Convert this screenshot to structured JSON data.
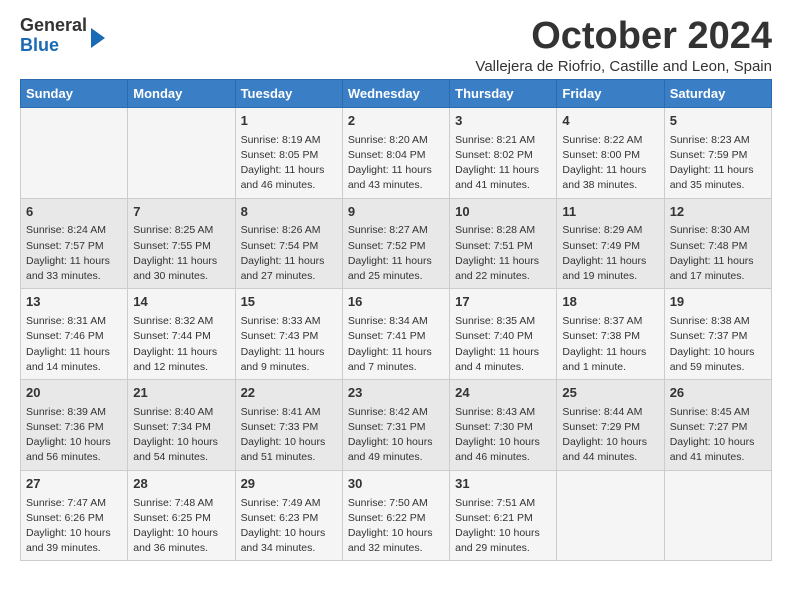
{
  "header": {
    "logo_general": "General",
    "logo_blue": "Blue",
    "month_title": "October 2024",
    "subtitle": "Vallejera de Riofrio, Castille and Leon, Spain"
  },
  "days_of_week": [
    "Sunday",
    "Monday",
    "Tuesday",
    "Wednesday",
    "Thursday",
    "Friday",
    "Saturday"
  ],
  "weeks": [
    [
      {
        "day": "",
        "info": ""
      },
      {
        "day": "",
        "info": ""
      },
      {
        "day": "1",
        "info": "Sunrise: 8:19 AM\nSunset: 8:05 PM\nDaylight: 11 hours and 46 minutes."
      },
      {
        "day": "2",
        "info": "Sunrise: 8:20 AM\nSunset: 8:04 PM\nDaylight: 11 hours and 43 minutes."
      },
      {
        "day": "3",
        "info": "Sunrise: 8:21 AM\nSunset: 8:02 PM\nDaylight: 11 hours and 41 minutes."
      },
      {
        "day": "4",
        "info": "Sunrise: 8:22 AM\nSunset: 8:00 PM\nDaylight: 11 hours and 38 minutes."
      },
      {
        "day": "5",
        "info": "Sunrise: 8:23 AM\nSunset: 7:59 PM\nDaylight: 11 hours and 35 minutes."
      }
    ],
    [
      {
        "day": "6",
        "info": "Sunrise: 8:24 AM\nSunset: 7:57 PM\nDaylight: 11 hours and 33 minutes."
      },
      {
        "day": "7",
        "info": "Sunrise: 8:25 AM\nSunset: 7:55 PM\nDaylight: 11 hours and 30 minutes."
      },
      {
        "day": "8",
        "info": "Sunrise: 8:26 AM\nSunset: 7:54 PM\nDaylight: 11 hours and 27 minutes."
      },
      {
        "day": "9",
        "info": "Sunrise: 8:27 AM\nSunset: 7:52 PM\nDaylight: 11 hours and 25 minutes."
      },
      {
        "day": "10",
        "info": "Sunrise: 8:28 AM\nSunset: 7:51 PM\nDaylight: 11 hours and 22 minutes."
      },
      {
        "day": "11",
        "info": "Sunrise: 8:29 AM\nSunset: 7:49 PM\nDaylight: 11 hours and 19 minutes."
      },
      {
        "day": "12",
        "info": "Sunrise: 8:30 AM\nSunset: 7:48 PM\nDaylight: 11 hours and 17 minutes."
      }
    ],
    [
      {
        "day": "13",
        "info": "Sunrise: 8:31 AM\nSunset: 7:46 PM\nDaylight: 11 hours and 14 minutes."
      },
      {
        "day": "14",
        "info": "Sunrise: 8:32 AM\nSunset: 7:44 PM\nDaylight: 11 hours and 12 minutes."
      },
      {
        "day": "15",
        "info": "Sunrise: 8:33 AM\nSunset: 7:43 PM\nDaylight: 11 hours and 9 minutes."
      },
      {
        "day": "16",
        "info": "Sunrise: 8:34 AM\nSunset: 7:41 PM\nDaylight: 11 hours and 7 minutes."
      },
      {
        "day": "17",
        "info": "Sunrise: 8:35 AM\nSunset: 7:40 PM\nDaylight: 11 hours and 4 minutes."
      },
      {
        "day": "18",
        "info": "Sunrise: 8:37 AM\nSunset: 7:38 PM\nDaylight: 11 hours and 1 minute."
      },
      {
        "day": "19",
        "info": "Sunrise: 8:38 AM\nSunset: 7:37 PM\nDaylight: 10 hours and 59 minutes."
      }
    ],
    [
      {
        "day": "20",
        "info": "Sunrise: 8:39 AM\nSunset: 7:36 PM\nDaylight: 10 hours and 56 minutes."
      },
      {
        "day": "21",
        "info": "Sunrise: 8:40 AM\nSunset: 7:34 PM\nDaylight: 10 hours and 54 minutes."
      },
      {
        "day": "22",
        "info": "Sunrise: 8:41 AM\nSunset: 7:33 PM\nDaylight: 10 hours and 51 minutes."
      },
      {
        "day": "23",
        "info": "Sunrise: 8:42 AM\nSunset: 7:31 PM\nDaylight: 10 hours and 49 minutes."
      },
      {
        "day": "24",
        "info": "Sunrise: 8:43 AM\nSunset: 7:30 PM\nDaylight: 10 hours and 46 minutes."
      },
      {
        "day": "25",
        "info": "Sunrise: 8:44 AM\nSunset: 7:29 PM\nDaylight: 10 hours and 44 minutes."
      },
      {
        "day": "26",
        "info": "Sunrise: 8:45 AM\nSunset: 7:27 PM\nDaylight: 10 hours and 41 minutes."
      }
    ],
    [
      {
        "day": "27",
        "info": "Sunrise: 7:47 AM\nSunset: 6:26 PM\nDaylight: 10 hours and 39 minutes."
      },
      {
        "day": "28",
        "info": "Sunrise: 7:48 AM\nSunset: 6:25 PM\nDaylight: 10 hours and 36 minutes."
      },
      {
        "day": "29",
        "info": "Sunrise: 7:49 AM\nSunset: 6:23 PM\nDaylight: 10 hours and 34 minutes."
      },
      {
        "day": "30",
        "info": "Sunrise: 7:50 AM\nSunset: 6:22 PM\nDaylight: 10 hours and 32 minutes."
      },
      {
        "day": "31",
        "info": "Sunrise: 7:51 AM\nSunset: 6:21 PM\nDaylight: 10 hours and 29 minutes."
      },
      {
        "day": "",
        "info": ""
      },
      {
        "day": "",
        "info": ""
      }
    ]
  ]
}
